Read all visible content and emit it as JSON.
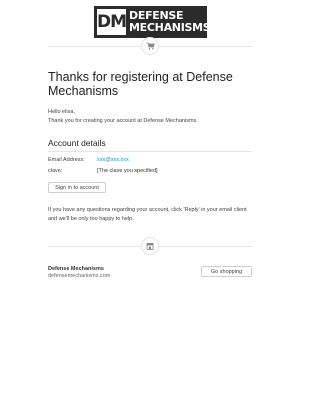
{
  "logo": {
    "mark": "DM",
    "line1": "DEFENSE",
    "line2": "MECHANISMS"
  },
  "icons": {
    "top_divider": "shopping-cart-icon",
    "bottom_divider": "store-icon"
  },
  "heading": "Thanks for registering at Defense Mechanisms",
  "greeting": {
    "hello": "Hello elisa,",
    "body": "Thank you for creating your account at Defense Mechanisms."
  },
  "account": {
    "section_title": "Account details",
    "email_label": "Email Address:",
    "email_value": "xxx@xxx.xxx",
    "password_label": "clave:",
    "password_value": "[The clave you specified]",
    "signin_label": "Sign in to account"
  },
  "help_text": "If you have any questions regarding your account, click 'Reply' in your email client and we'll be only too happy to help.",
  "footer": {
    "store_name": "Defense Mechanisms",
    "store_url": "defensemechanisms.com",
    "shop_button": "Go shopping"
  },
  "colors": {
    "link": "#1a8fd6",
    "logo_bg": "#2b2b2b",
    "divider": "#e6e6e6"
  }
}
